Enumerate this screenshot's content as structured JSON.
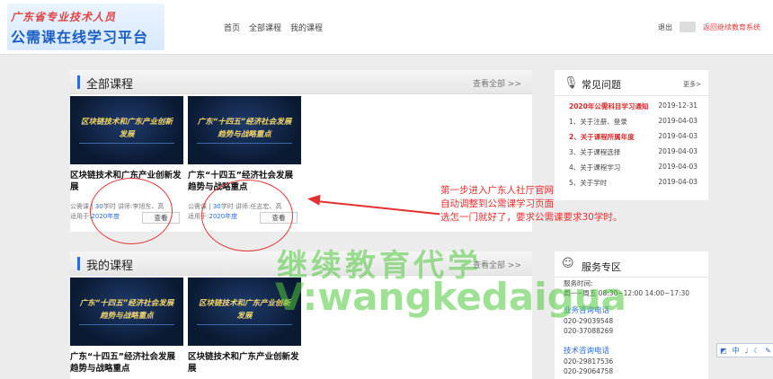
{
  "header": {
    "logo_sub": "广东省专业技术人员",
    "logo_main": "公需课在线学习平台",
    "nav": [
      "首页",
      "全部课程",
      "我的课程"
    ],
    "logout": "退出",
    "return_link": "返回继续教育系统"
  },
  "all_courses": {
    "title": "全部课程",
    "more": "查看全部 >>",
    "courses": [
      {
        "thumb_text": "区块链技术和广东产业创新发展",
        "title": "区块链技术和广东产业创新发展",
        "meta_prefix": "公需课",
        "hours": "30",
        "hours_unit": "学时",
        "lecturer": "讲师:李旭东、高",
        "year_prefix": "适用于:",
        "year": "2020年度",
        "button": "查看"
      },
      {
        "thumb_text": "广东“十四五”经济社会发展趋势与战略重点",
        "title": "广东“十四五”经济社会发展趋势与战略重点",
        "meta_prefix": "公需课",
        "hours": "30",
        "hours_unit": "学时",
        "lecturer": "讲师:任志宏、高",
        "year_prefix": "适用于:",
        "year": "2020年度",
        "button": "查看"
      }
    ]
  },
  "my_courses": {
    "title": "我的课程",
    "more": "查看全部 >>",
    "courses": [
      {
        "thumb_text": "广东“十四五”经济社会发展趋势与战略重点",
        "title": "广东“十四五”经济社会发展趋势与战略重点"
      },
      {
        "thumb_text": "区块链技术和广东产业创新发展",
        "title": "区块链技术和广东产业创新发展"
      }
    ]
  },
  "faq": {
    "title": "常见问题",
    "more": "更多>",
    "items": [
      {
        "label": "2020年公需科目学习通知",
        "date": "2019-12-31"
      },
      {
        "label": "1、关于注册、登录",
        "date": "2019-04-03"
      },
      {
        "label": "2、关于课程所属年度",
        "date": "2019-04-03"
      },
      {
        "label": "3、关于课程选择",
        "date": "2019-04-03"
      },
      {
        "label": "4、关于课程学习",
        "date": "2019-04-03"
      },
      {
        "label": "5、关于学时",
        "date": "2019-04-03"
      }
    ]
  },
  "service": {
    "title": "服务专区",
    "hours_label": "服务时间:",
    "hours_value": "周一~周五 08:30~12:00 14:00~17:30",
    "biz_label": "业务咨询电话",
    "biz_phones": [
      "020-29039548",
      "020-37088269"
    ],
    "tech_label": "技术咨询电话",
    "tech_phones": [
      "020-29817536",
      "020-29064758"
    ]
  },
  "annotation": {
    "line1": "第一步进入广东人社厅官网",
    "line2": "自动调整到公需课学习页面",
    "line3": "选怎一门就好了，要求公需课要求30学时。"
  },
  "watermark": {
    "line1": "继续教育代学",
    "line2": "V:wangkedaigua"
  },
  "side_tools": [
    "◩",
    "中",
    "♩",
    "☾",
    "✎"
  ],
  "colors": {
    "accent": "#2b6cd4",
    "annotation_red": "#e53030",
    "watermark_green": "#50c83c"
  }
}
